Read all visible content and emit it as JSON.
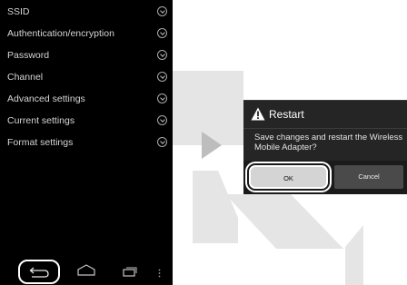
{
  "settings_menu": {
    "items": [
      {
        "label": "SSID"
      },
      {
        "label": "Authentication/encryption"
      },
      {
        "label": "Password"
      },
      {
        "label": "Channel"
      },
      {
        "label": "Advanced settings"
      },
      {
        "label": "Current settings"
      },
      {
        "label": "Format settings"
      }
    ]
  },
  "navbar": {
    "icons": [
      "back-icon",
      "home-icon",
      "recent-apps-icon",
      "overflow-menu-icon"
    ]
  },
  "dialog": {
    "title": "Restart",
    "message": "Save changes and restart the Wireless Mobile Adapter?",
    "ok_label": "OK",
    "cancel_label": "Cancel",
    "title_icon": "warning-icon"
  },
  "colors": {
    "screen_bg": "#000000",
    "dialog_bg": "#252525",
    "ok_button_bg": "#d4d4d4",
    "cancel_button_bg": "#4a4a4a",
    "decoration_gray": "#e5e5e5"
  }
}
